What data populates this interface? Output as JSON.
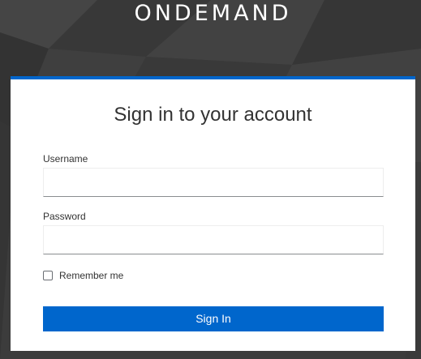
{
  "brand": {
    "name": "ONDEMAND"
  },
  "login": {
    "title": "Sign in to your account",
    "username_label": "Username",
    "username_value": "",
    "password_label": "Password",
    "password_value": "",
    "remember_label": "Remember me",
    "remember_checked": false,
    "submit_label": "Sign In"
  },
  "colors": {
    "accent": "#0066cc",
    "background": "#3e3e3e",
    "card": "#ffffff"
  }
}
